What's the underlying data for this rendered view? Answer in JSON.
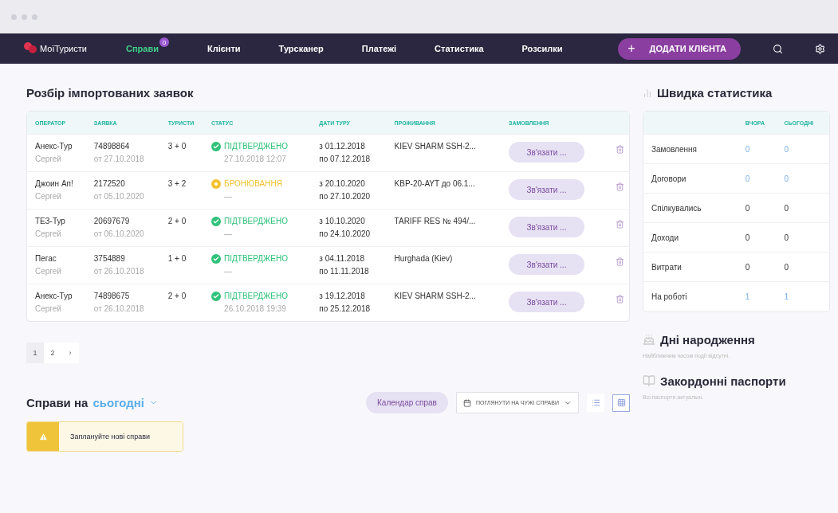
{
  "nav": {
    "logo": "МоїТуристи",
    "items": [
      {
        "label": "Справи",
        "selected": true,
        "badge": "0"
      },
      {
        "label": "Клієнти",
        "selected": false
      },
      {
        "label": "Турсканер",
        "selected": false
      },
      {
        "label": "Платежі",
        "selected": false
      },
      {
        "label": "Статистика",
        "selected": false
      },
      {
        "label": "Розсилки",
        "selected": false
      }
    ],
    "add_button": {
      "icon": "+",
      "label": "ДОДАТИ КЛІЄНТА"
    }
  },
  "imports": {
    "title": "Розбір імпортованих заявок",
    "columns": [
      "ОПЕРАТОР",
      "ЗАЯВКА",
      "ТУРИСТИ",
      "СТАТУС",
      "ДАТИ ТУРУ",
      "ПРОЖИВАННЯ",
      "ЗАМОВЛЕННЯ"
    ],
    "rows": [
      {
        "operator": "Анекс-Тур",
        "manager": "Сергей",
        "order": "74898864",
        "order_date": "от 27.10.2018",
        "tourists": "3 + 0",
        "kind": "confirmed",
        "color": "#2fc27a",
        "status_label": "ПІДТВЕРДЖЕНО",
        "status_date": "27.10.2018 12:07",
        "date_from": "з 01.12.2018",
        "date_to": "по 07.12.2018",
        "hotel": "KIEV SHARM SSH-2...",
        "action": "Зв'язати ..."
      },
      {
        "operator": "Джоин Ап!",
        "manager": "Сергей",
        "order": "2172520",
        "order_date": "от 05.10.2020",
        "tourists": "3 + 2",
        "kind": "booking",
        "color": "#f2c230",
        "status_label": "БРОНЮВАННЯ",
        "status_date": "—",
        "date_from": "з 20.10.2020",
        "date_to": "по 27.10.2020",
        "hotel": "KBP-20-AYT до 06.1...",
        "action": "Зв'язати ..."
      },
      {
        "operator": "ТЕЗ-Тур",
        "manager": "Сергей",
        "order": "20697679",
        "order_date": "от 06.10.2020",
        "tourists": "2 + 0",
        "kind": "confirmed",
        "color": "#2fc27a",
        "status_label": "ПІДТВЕРДЖЕНО",
        "status_date": "—",
        "date_from": "з 10.10.2020",
        "date_to": "по 24.10.2020",
        "hotel": "TARIFF RES № 494/...",
        "action": "Зв'язати ..."
      },
      {
        "operator": "Пегас",
        "manager": "Сергей",
        "order": "3754889",
        "order_date": "от 26.10.2018",
        "tourists": "1 + 0",
        "kind": "confirmed",
        "color": "#2fc27a",
        "status_label": "ПІДТВЕРДЖЕНО",
        "status_date": "—",
        "date_from": "з 04.11.2018",
        "date_to": "по 11.11.2018",
        "hotel": "Hurghada (Kiev)",
        "action": "Зв'язати ..."
      },
      {
        "operator": "Анекс-Тур",
        "manager": "Сергей",
        "order": "74898675",
        "order_date": "от 26.10.2018",
        "tourists": "2 + 0",
        "kind": "confirmed",
        "color": "#2fc27a",
        "status_label": "ПІДТВЕРДЖЕНО",
        "status_date": "26.10.2018 19:39",
        "date_from": "з 19.12.2018",
        "date_to": "по 25.12.2018",
        "hotel": "KIEV SHARM SSH-2...",
        "action": "Зв'язати ..."
      }
    ],
    "pagination": [
      {
        "label": "1",
        "selected": true
      },
      {
        "label": "2",
        "selected": false
      },
      {
        "label": "›",
        "selected": false
      }
    ]
  },
  "tasks": {
    "title": "Справи на",
    "period": "сьогодні",
    "calendar_button": "Календар справ",
    "others_button": "ПОГЛЯНУТИ НА ЧУЖІ СПРАВИ",
    "views": [
      {
        "kind": "list",
        "selected": false
      },
      {
        "kind": "grid",
        "selected": true
      }
    ],
    "alert": "Заплануйте нові справи"
  },
  "stats": {
    "title": "Швидка статистика",
    "columns": [
      "ВЧОРА",
      "СЬОГОДНІ"
    ],
    "rows": [
      {
        "label": "Замовлення",
        "yesterday": "0",
        "today": "0",
        "link": true
      },
      {
        "label": "Договори",
        "yesterday": "0",
        "today": "0",
        "link": true
      },
      {
        "label": "Спілкувались",
        "yesterday": "0",
        "today": "0",
        "link": false
      },
      {
        "label": "Доходи",
        "yesterday": "0",
        "today": "0",
        "link": false
      },
      {
        "label": "Витрати",
        "yesterday": "0",
        "today": "0",
        "link": false
      },
      {
        "label": "На роботі",
        "yesterday": "1",
        "today": "1",
        "link": true
      }
    ]
  },
  "birthdays": {
    "title": "Дні народження",
    "text": "Найближчим часом події відсутні."
  },
  "passports": {
    "title": "Закордонні паспорти",
    "text": "Всі паспорти актуальні."
  }
}
